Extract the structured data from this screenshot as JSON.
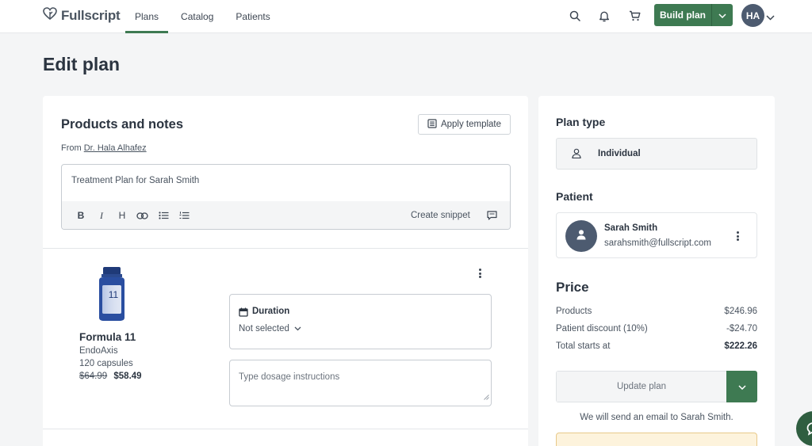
{
  "brand": {
    "name": "Fullscript"
  },
  "nav": {
    "items": [
      {
        "label": "Plans"
      },
      {
        "label": "Catalog"
      },
      {
        "label": "Patients"
      }
    ]
  },
  "header": {
    "build_plan_label": "Build plan",
    "user_initials": "HA"
  },
  "page": {
    "title": "Edit plan"
  },
  "products": {
    "title": "Products and notes",
    "apply_template_label": "Apply template",
    "from_prefix": "From",
    "from_name": "Dr. Hala Alhafez",
    "editor_text": "Treatment Plan for Sarah Smith",
    "toolbar": {
      "bold": "B",
      "italic": "I",
      "heading": "H",
      "create_snippet_label": "Create snippet"
    },
    "item": {
      "name": "Formula 11",
      "brand": "EndoAxis",
      "size": "120 capsules",
      "original_price": "$64.99",
      "price": "$58.49",
      "bottle_label": "11",
      "duration_title": "Duration",
      "duration_value": "Not selected",
      "dosage_placeholder": "Type dosage instructions"
    }
  },
  "sidebar": {
    "plan_type_title": "Plan type",
    "plan_type_value": "Individual",
    "patient_title": "Patient",
    "patient": {
      "name": "Sarah Smith",
      "email": "sarahsmith@fullscript.com"
    },
    "price_title": "Price",
    "price_rows": [
      {
        "label": "Products",
        "value": "$246.96"
      },
      {
        "label": "Patient discount (10%)",
        "value": "-$24.70"
      },
      {
        "label": "Total starts at",
        "value": "$222.26"
      }
    ],
    "update_plan_label": "Update plan",
    "email_note": "We will send an email to Sarah Smith."
  },
  "colors": {
    "accent": "#3e7a52",
    "avatar": "#4d5b70",
    "background": "#f4f5f6"
  },
  "icons": [
    "fullscript-logo-icon",
    "search-icon",
    "bell-icon",
    "cart-icon",
    "chevron-down-icon",
    "template-icon",
    "comment-icon",
    "calendar-icon",
    "person-icon",
    "kebab-menu-icon",
    "chat-icon"
  ]
}
